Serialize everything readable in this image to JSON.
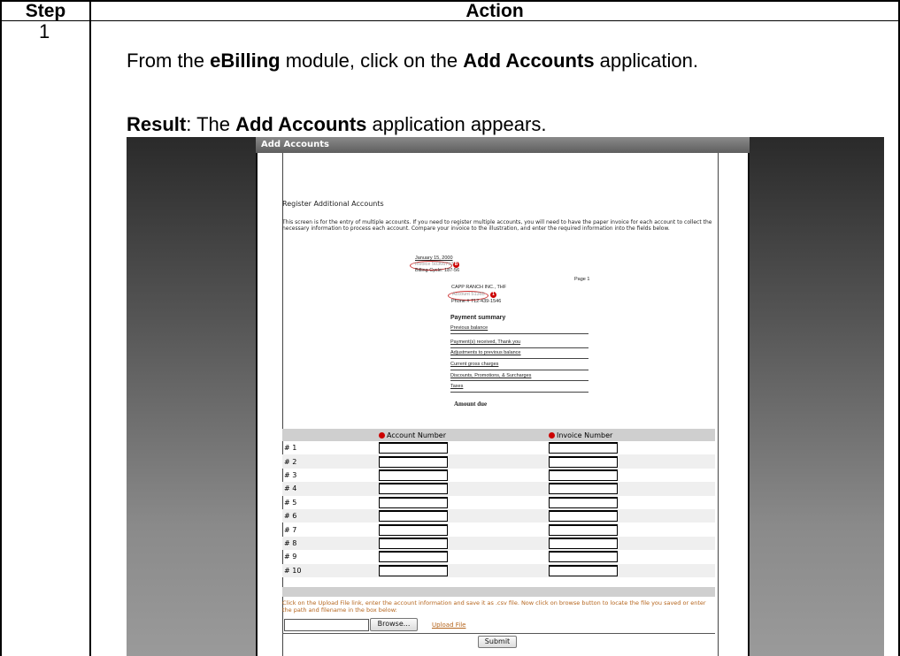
{
  "table": {
    "header_step": "Step",
    "header_action": "Action",
    "step_number": "1",
    "line1_pre": "From the ",
    "line1_b1": "eBilling",
    "line1_mid": " module, click on the ",
    "line1_b2": "Add Accounts",
    "line1_post": " application.",
    "result_label": "Result",
    "result_pre": ":  The ",
    "result_b": "Add Accounts",
    "result_post": " application appears."
  },
  "screenshot": {
    "window_title": "Add Accounts",
    "register_title": "Register Additional Accounts",
    "description": "This screen is for the entry of multiple accounts. If you need to register multiple accounts, you will need to have the paper invoice for each account to collect the necessary information to process each account. Compare your invoice to the illustration, and enter the required information into the fields below.",
    "invoice": {
      "date": "January 15, 2000",
      "invoice_no": "Invoice 5036679233",
      "billing_cycle": "Billing Cycle: 187-56",
      "page": "Page 1",
      "company": "CAPP RANCH INC., THF",
      "account": "Account  51365",
      "phone": "Phone # 712-439-1546",
      "summary_title": "Payment summary",
      "summary_items": [
        "Previous balance",
        "Payment(s) received, Thank you",
        "Adjustments to previous balance",
        "Current gross charges",
        "Discounts, Promotions, & Surcharges",
        "Taxes"
      ],
      "amount_due": "Amount due",
      "marker_b": "B",
      "marker_a": "1"
    },
    "col_account": "Account Number",
    "col_invoice": "Invoice Number",
    "rows": [
      "# 1",
      "# 2",
      "# 3",
      "# 4",
      "# 5",
      "# 6",
      "# 7",
      "# 8",
      "# 9",
      "# 10"
    ],
    "upload_note": "Click on the Upload File link, enter the account information and save it as .csv file. Now click on browse button to locate the file you saved or enter the path and filename in the box below:",
    "browse_label": "Browse...",
    "upload_link": "Upload File",
    "submit_label": "Submit"
  }
}
